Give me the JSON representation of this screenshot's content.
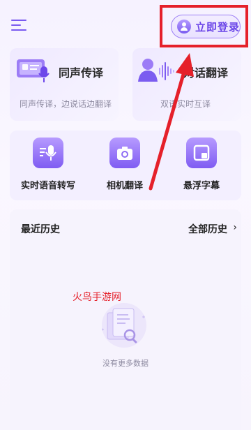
{
  "header": {
    "login_label": "立即登录"
  },
  "cards": [
    {
      "title": "同声传译",
      "desc": "同声传译，边说话边翻译"
    },
    {
      "title": "对话翻译",
      "desc": "双语实时互译"
    }
  ],
  "tools": [
    {
      "label": "实时语音转写",
      "icon": "mic-text-icon"
    },
    {
      "label": "相机翻译",
      "icon": "camera-icon"
    },
    {
      "label": "悬浮字幕",
      "icon": "floating-window-icon"
    }
  ],
  "history": {
    "title": "最近历史",
    "all_label": "全部历史",
    "empty_text": "没有更多数据"
  },
  "watermark": "火鸟手游网",
  "colors": {
    "accent": "#7b5cf0",
    "highlight": "#e5202a"
  }
}
